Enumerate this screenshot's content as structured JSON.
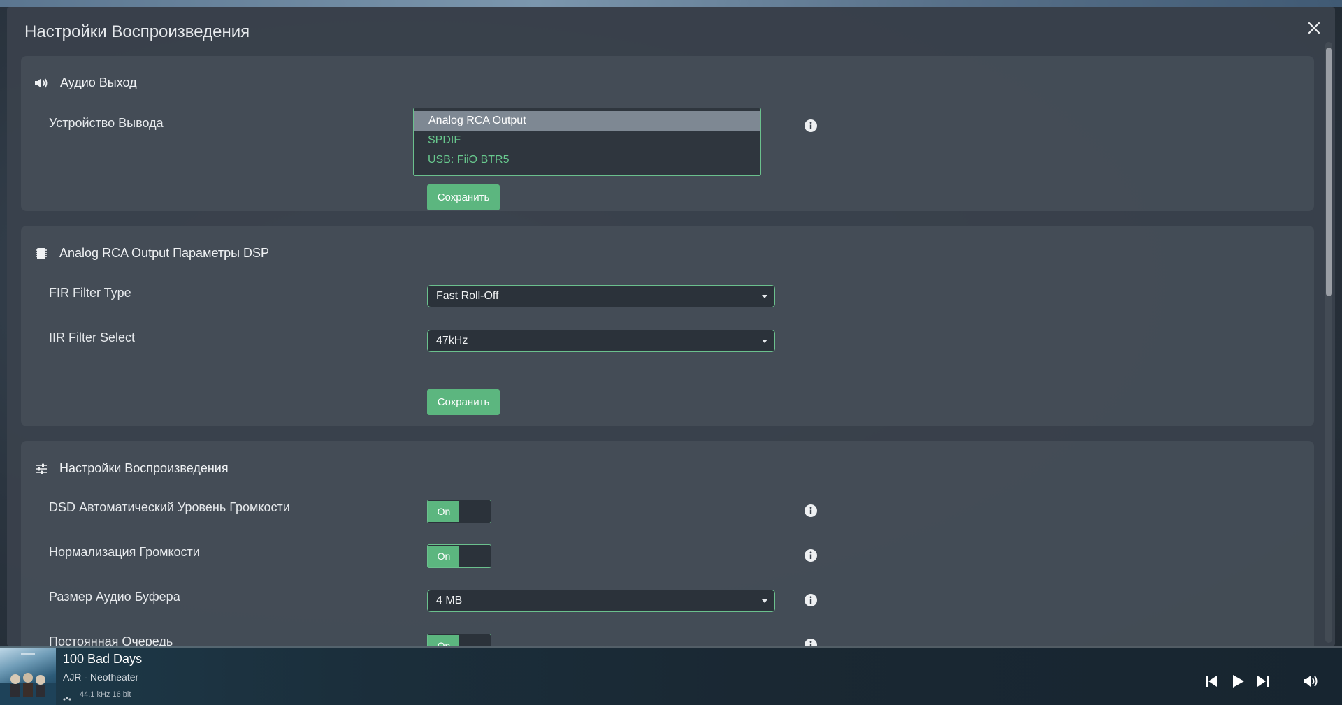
{
  "modal": {
    "title": "Настройки Воспроизведения"
  },
  "audio_output": {
    "title": "Аудио Выход",
    "device_label": "Устройство Вывода",
    "options": [
      "Analog RCA Output",
      "SPDIF",
      "USB: FiiO BTR5"
    ],
    "selected": "Analog RCA Output",
    "save_label": "Сохранить"
  },
  "dsp": {
    "title": "Analog RCA Output Параметры DSP",
    "fir_label": "FIR Filter Type",
    "fir_value": "Fast Roll-Off",
    "iir_label": "IIR Filter Select",
    "iir_value": "47kHz",
    "save_label": "Сохранить"
  },
  "playback": {
    "title": "Настройки Воспроизведения",
    "dsd_label": "DSD Автоматический Уровень Громкости",
    "dsd_toggle": "On",
    "normalize_label": "Нормализация Громкости",
    "normalize_toggle": "On",
    "buffer_label": "Размер Аудио Буфера",
    "buffer_value": "4 MB",
    "queue_label": "Постоянная Очередь",
    "queue_toggle": "On"
  },
  "player": {
    "track_title": "100 Bad Days",
    "artist_album": "AJR - Neotheater",
    "quality": "44.1 kHz 16 bit"
  },
  "colors": {
    "accent": "#5cb67f",
    "accent_text": "#68c98e",
    "modal_bg": "#3a424c"
  },
  "icons": [
    "close-icon",
    "speaker-icon",
    "chip-icon",
    "sliders-icon",
    "info-icon",
    "skip-back-icon",
    "play-icon",
    "skip-forward-icon",
    "volume-icon",
    "quality-icon"
  ]
}
